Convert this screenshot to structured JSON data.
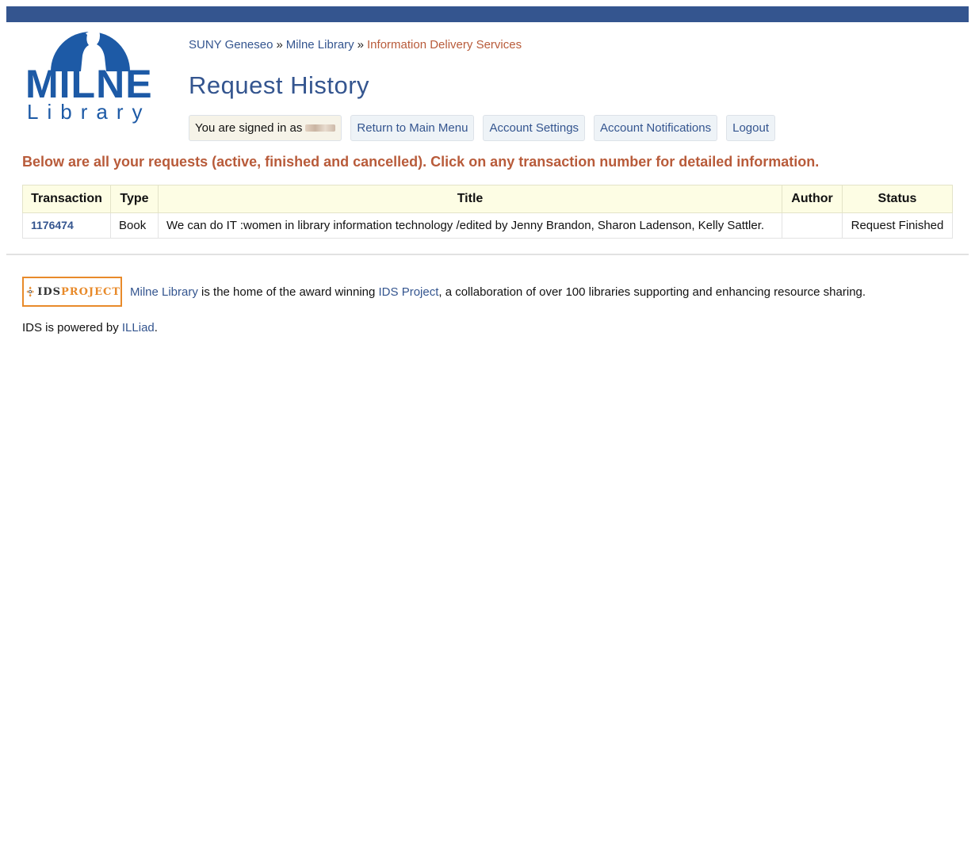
{
  "colors": {
    "brand_blue": "#34558f",
    "logo_blue": "#1d5aa6",
    "accent_rust": "#b85b3a",
    "table_header_bg": "#fdfde4",
    "ids_orange": "#e88a2a"
  },
  "logo": {
    "line1": "MILNE",
    "line2": "Library",
    "icon": "library-silhouette-icon"
  },
  "breadcrumb": {
    "items": [
      "SUNY Geneseo",
      "Milne Library"
    ],
    "current": "Information Delivery Services",
    "separator": "»"
  },
  "page": {
    "title": "Request History"
  },
  "nav": {
    "signed_in_label": "You are signed in as",
    "buttons": [
      "Return to Main Menu",
      "Account Settings",
      "Account Notifications",
      "Logout"
    ]
  },
  "intro_text": "Below are all your requests (active, finished and cancelled). Click on any transaction number for detailed information.",
  "table": {
    "headers": [
      "Transaction",
      "Type",
      "Title",
      "Author",
      "Status"
    ],
    "rows": [
      {
        "transaction": "1176474",
        "type": "Book",
        "title": "We can do IT :women in library information technology /edited by Jenny Brandon, Sharon Ladenson, Kelly Sattler.",
        "author": "",
        "status": "Request Finished"
      }
    ]
  },
  "footer": {
    "ids_logo": {
      "word1": "IDS",
      "word2": "PROJECT",
      "icon": "ids-project-icon"
    },
    "link1": "Milne Library",
    "text1": " is the home of the award winning ",
    "link2": "IDS Project",
    "text2": ", a collaboration of over 100 libraries supporting and enhancing resource sharing.",
    "powered_prefix": "IDS is powered by ",
    "powered_link": "ILLiad",
    "powered_suffix": "."
  }
}
